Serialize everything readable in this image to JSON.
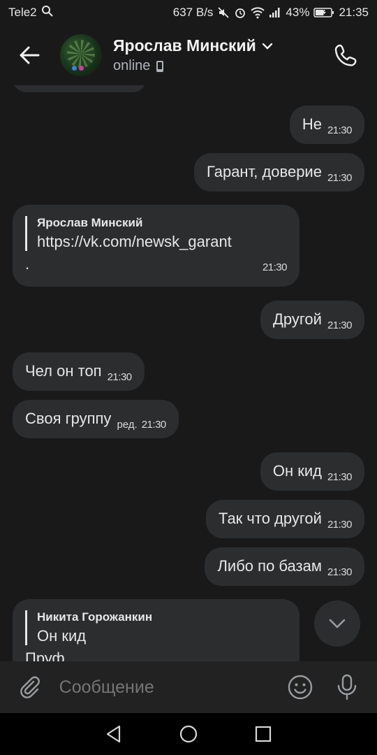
{
  "status_bar": {
    "carrier": "Tele2",
    "speed": "637 B/s",
    "battery": "43%",
    "time": "21:35"
  },
  "header": {
    "name": "Ярослав Минский",
    "status": "online"
  },
  "messages": [
    {
      "side": "out",
      "text": "Не",
      "time": "21:30"
    },
    {
      "side": "out",
      "text": "Гарант, доверие",
      "time": "21:30"
    },
    {
      "side": "in",
      "reply_name": "Ярослав Минский",
      "reply_text": "https://vk.com/newsk_garant",
      "text": ".",
      "time": "21:30"
    },
    {
      "side": "out",
      "text": "Другой",
      "time": "21:30"
    },
    {
      "side": "in",
      "text": "Чел он топ",
      "time": "21:30"
    },
    {
      "side": "in",
      "text": "Своя группу",
      "edited": "ред.",
      "time": "21:30"
    },
    {
      "side": "out",
      "text": "Он кид",
      "time": "21:30"
    },
    {
      "side": "out",
      "text": "Так что другой",
      "time": "21:30"
    },
    {
      "side": "out",
      "text": "Либо по базам",
      "time": "21:30"
    },
    {
      "side": "in",
      "reply_name": "Никита Горожанкин",
      "reply_text": "Он кид",
      "text": "Пруф",
      "time": ""
    }
  ],
  "composer": {
    "placeholder": "Сообщение"
  }
}
